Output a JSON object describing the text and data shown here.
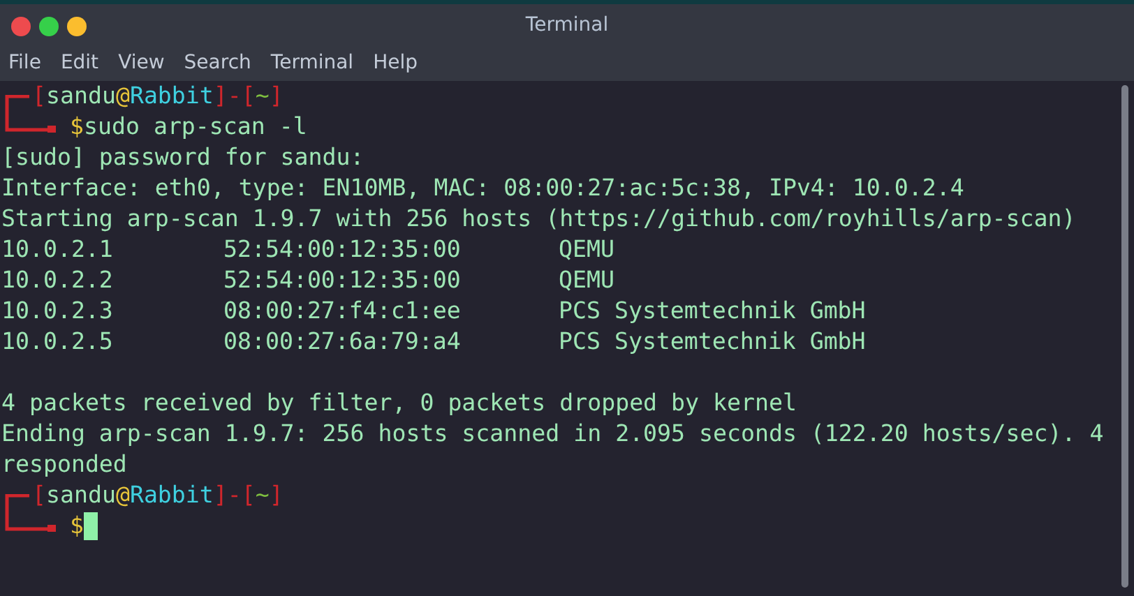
{
  "window": {
    "title": "Terminal"
  },
  "menu": [
    "File",
    "Edit",
    "View",
    "Search",
    "Terminal",
    "Help"
  ],
  "blocks": [
    {
      "kind": "prompt",
      "segments": [
        {
          "kind": "bracket",
          "text": "["
        },
        {
          "kind": "user",
          "text": "sandu"
        },
        {
          "kind": "at",
          "text": "@"
        },
        {
          "kind": "host",
          "text": "Rabbit"
        },
        {
          "kind": "bracket",
          "text": "]-["
        },
        {
          "kind": "dir",
          "text": "~"
        },
        {
          "kind": "bracket",
          "text": "]"
        }
      ],
      "sign": "$",
      "command": "sudo arp-scan -l",
      "cursor": false
    },
    {
      "kind": "text",
      "text": "[sudo] password for sandu:"
    },
    {
      "kind": "text",
      "text": "Interface: eth0, type: EN10MB, MAC: 08:00:27:ac:5c:38, IPv4: 10.0.2.4"
    },
    {
      "kind": "text",
      "text": "Starting arp-scan 1.9.7 with 256 hosts (https://github.com/royhills/arp-scan)"
    },
    {
      "kind": "host_row",
      "cells": [
        "10.0.2.1",
        "52:54:00:12:35:00",
        "QEMU"
      ]
    },
    {
      "kind": "host_row",
      "cells": [
        "10.0.2.2",
        "52:54:00:12:35:00",
        "QEMU"
      ]
    },
    {
      "kind": "host_row",
      "cells": [
        "10.0.2.3",
        "08:00:27:f4:c1:ee",
        "PCS Systemtechnik GmbH"
      ]
    },
    {
      "kind": "host_row",
      "cells": [
        "10.0.2.5",
        "08:00:27:6a:79:a4",
        "PCS Systemtechnik GmbH"
      ]
    },
    {
      "kind": "blank"
    },
    {
      "kind": "text",
      "text": "4 packets received by filter, 0 packets dropped by kernel"
    },
    {
      "kind": "text",
      "text": "Ending arp-scan 1.9.7: 256 hosts scanned in 2.095 seconds (122.20 hosts/sec). 4"
    },
    {
      "kind": "text",
      "text": "responded"
    },
    {
      "kind": "prompt",
      "segments": [
        {
          "kind": "bracket",
          "text": "["
        },
        {
          "kind": "user",
          "text": "sandu"
        },
        {
          "kind": "at",
          "text": "@"
        },
        {
          "kind": "host",
          "text": "Rabbit"
        },
        {
          "kind": "bracket",
          "text": "]-["
        },
        {
          "kind": "dir",
          "text": "~"
        },
        {
          "kind": "bracket",
          "text": "]"
        }
      ],
      "sign": "$",
      "cursor": true
    }
  ]
}
